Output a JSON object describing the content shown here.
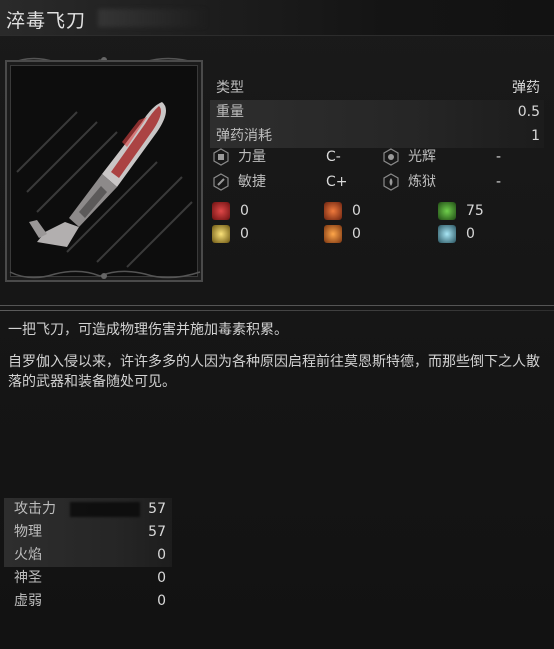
{
  "item": {
    "name": "淬毒飞刀"
  },
  "stats": [
    {
      "label": "类型",
      "value": "弹药"
    },
    {
      "label": "重量",
      "value": "0.5"
    },
    {
      "label": "弹药消耗",
      "value": "1"
    }
  ],
  "scaling": [
    {
      "name": "力量",
      "grade": "C-",
      "icon": "strength-icon"
    },
    {
      "name": "光辉",
      "grade": "-",
      "icon": "radiance-icon"
    },
    {
      "name": "敏捷",
      "grade": "C+",
      "icon": "agility-icon"
    },
    {
      "name": "炼狱",
      "grade": "-",
      "icon": "inferno-icon"
    }
  ],
  "buildup": [
    {
      "icon": "bleed-icon",
      "value": "0",
      "color": "#b3262a"
    },
    {
      "icon": "burn-icon",
      "value": "0",
      "color": "#d2562a"
    },
    {
      "icon": "poison-icon",
      "value": "75",
      "color": "#3f8a2e"
    },
    {
      "icon": "holy-icon",
      "value": "0",
      "color": "#d8b740"
    },
    {
      "icon": "fire-icon",
      "value": "0",
      "color": "#e27a2c"
    },
    {
      "icon": "frost-icon",
      "value": "0",
      "color": "#6fb1c8"
    }
  ],
  "description": {
    "line1": "一把飞刀，可造成物理伤害并施加毒素积累。",
    "line2": "自罗伽入侵以来，许许多多的人因为各种原因启程前往莫恩斯特德，而那些倒下之人散落的武器和装备随处可见。"
  },
  "attack": {
    "header_label": "攻击力",
    "header_value": "57",
    "rows": [
      {
        "label": "物理",
        "value": "57"
      },
      {
        "label": "火焰",
        "value": "0"
      },
      {
        "label": "神圣",
        "value": "0"
      },
      {
        "label": "虚弱",
        "value": "0"
      }
    ]
  }
}
